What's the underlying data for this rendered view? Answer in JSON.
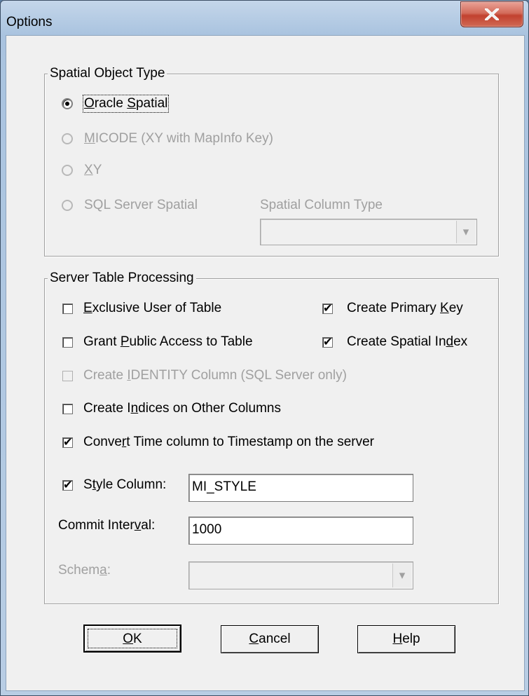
{
  "window": {
    "title": "Options"
  },
  "spatial_group": {
    "legend": "Spatial Object Type",
    "options": [
      {
        "pre": "",
        "key": "O",
        "post": "racle ",
        "key2": "S",
        "post2": "patial",
        "selected": true,
        "enabled": true
      },
      {
        "pre": "",
        "key": "M",
        "post": "ICODE (XY with MapInfo Key)",
        "selected": false,
        "enabled": false
      },
      {
        "pre": "",
        "key": "X",
        "post": "Y",
        "selected": false,
        "enabled": false
      },
      {
        "pre": "SQL Server Spatial",
        "key": "",
        "post": "",
        "selected": false,
        "enabled": false
      }
    ],
    "column_type_label": "Spatial Column Type",
    "column_type_value": ""
  },
  "server_group": {
    "legend": "Server Table Processing",
    "exclusive": {
      "key": "E",
      "rest": "xclusive User of Table",
      "checked": false
    },
    "grant": {
      "pre": "Grant ",
      "key": "P",
      "rest": "ublic Access to Table",
      "checked": false
    },
    "identity": {
      "pre": "Create ",
      "key": "I",
      "rest": "DENTITY Column (SQL Server only)",
      "checked": false
    },
    "indices": {
      "pre": "Create I",
      "key": "n",
      "rest": "dices on Other Columns",
      "checked": false
    },
    "convert": {
      "pre": "Conve",
      "key": "r",
      "rest": "t Time column to Timestamp on the server",
      "checked": true
    },
    "primary_key": {
      "pre": "Create Primary ",
      "key": "K",
      "rest": "ey",
      "checked": true
    },
    "spatial_index": {
      "pre": "Create Spatial In",
      "key": "d",
      "rest": "ex",
      "checked": true
    },
    "style_column": {
      "pre": "S",
      "key": "t",
      "rest": "yle Column:",
      "checked": true,
      "value": "MI_STYLE"
    },
    "commit": {
      "pre": "Commit Inter",
      "key": "v",
      "rest": "al:",
      "value": "1000"
    },
    "schema": {
      "pre": "Schem",
      "key": "a",
      "rest": ":",
      "value": ""
    }
  },
  "buttons": {
    "ok": {
      "key": "O",
      "rest": "K"
    },
    "cancel": {
      "key": "C",
      "rest": "ancel"
    },
    "help": {
      "key": "H",
      "rest": "elp"
    }
  },
  "check_glyph": "✔",
  "radio_dot_glyph": "",
  "icons": {
    "close": "close-icon",
    "dropdown": "chevron-down-icon"
  },
  "colors": {
    "close_button": "#c2412f",
    "disabled_text": "#a0a0a0",
    "dialog_bg": "#f0f0f0"
  }
}
